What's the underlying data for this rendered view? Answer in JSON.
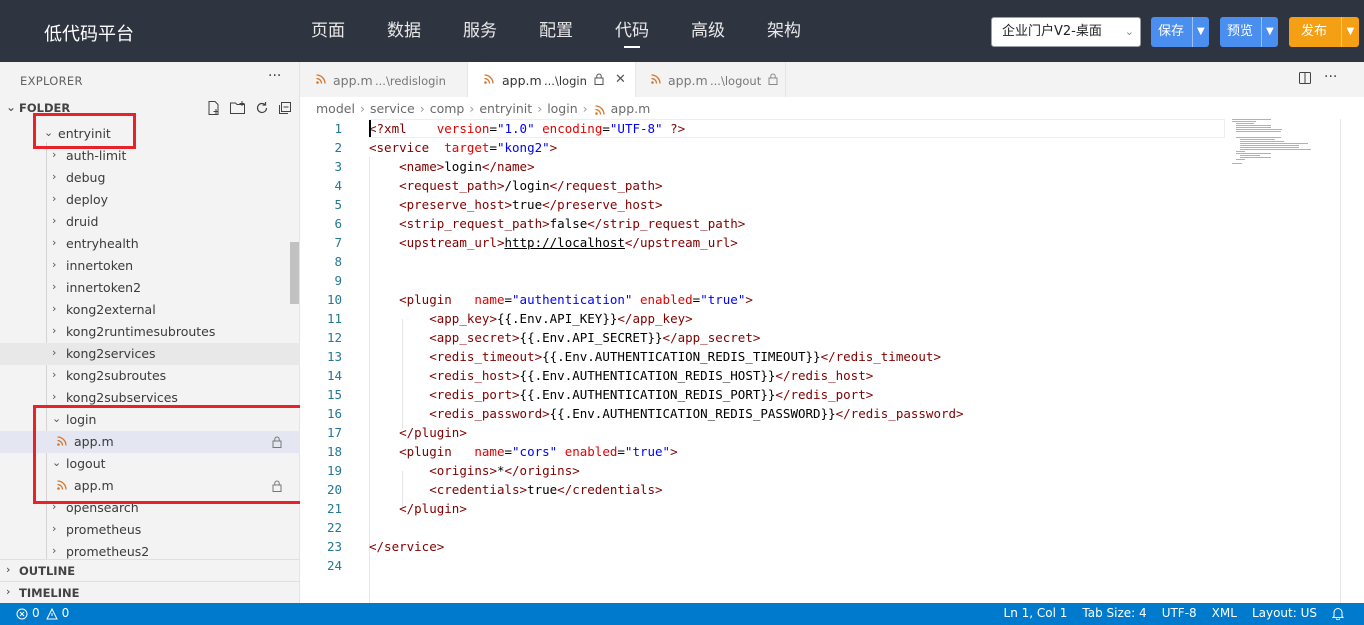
{
  "app": {
    "title": "低代码平台"
  },
  "nav": [
    {
      "label": "页面",
      "active": false
    },
    {
      "label": "数据",
      "active": false
    },
    {
      "label": "服务",
      "active": false
    },
    {
      "label": "配置",
      "active": false
    },
    {
      "label": "代码",
      "active": true
    },
    {
      "label": "高级",
      "active": false
    },
    {
      "label": "架构",
      "active": false
    }
  ],
  "app_select": {
    "value": "企业门户V2-桌面"
  },
  "buttons": {
    "save": "保存",
    "preview": "预览",
    "publish": "发布"
  },
  "explorer": {
    "title": "EXPLORER",
    "folder": "FOLDER",
    "tree": [
      {
        "label": "entryinit",
        "level": 1,
        "expanded": true
      },
      {
        "label": "auth-limit",
        "level": 2,
        "expanded": false
      },
      {
        "label": "debug",
        "level": 2,
        "expanded": false
      },
      {
        "label": "deploy",
        "level": 2,
        "expanded": false
      },
      {
        "label": "druid",
        "level": 2,
        "expanded": false
      },
      {
        "label": "entryhealth",
        "level": 2,
        "expanded": false
      },
      {
        "label": "innertoken",
        "level": 2,
        "expanded": false
      },
      {
        "label": "innertoken2",
        "level": 2,
        "expanded": false
      },
      {
        "label": "kong2external",
        "level": 2,
        "expanded": false
      },
      {
        "label": "kong2runtimesubroutes",
        "level": 2,
        "expanded": false
      },
      {
        "label": "kong2services",
        "level": 2,
        "expanded": false
      },
      {
        "label": "kong2subroutes",
        "level": 2,
        "expanded": false
      },
      {
        "label": "kong2subservices",
        "level": 2,
        "expanded": false
      },
      {
        "label": "login",
        "level": 2,
        "expanded": true
      },
      {
        "label": "app.m",
        "level": 3,
        "file": true,
        "selected": true
      },
      {
        "label": "logout",
        "level": 2,
        "expanded": true
      },
      {
        "label": "app.m",
        "level": 3,
        "file": true
      },
      {
        "label": "opensearch",
        "level": 2,
        "expanded": false
      },
      {
        "label": "prometheus",
        "level": 2,
        "expanded": false
      },
      {
        "label": "prometheus2",
        "level": 2,
        "expanded": false
      }
    ],
    "outline": "OUTLINE",
    "timeline": "TIMELINE"
  },
  "tabs": [
    {
      "name": "app.m",
      "desc": "...\\redislogin",
      "active": false
    },
    {
      "name": "app.m",
      "desc": "...\\login",
      "active": true
    },
    {
      "name": "app.m",
      "desc": "...\\logout",
      "active": false
    }
  ],
  "breadcrumb": [
    "model",
    "service",
    "comp",
    "entryinit",
    "login",
    "app.m"
  ],
  "code_lines": [
    "<?xml version=\"1.0\" encoding=\"UTF-8\" ?>",
    "<service target=\"kong2\">",
    "    <name>login</name>",
    "    <request_path>/login</request_path>",
    "    <preserve_host>true</preserve_host>",
    "    <strip_request_path>false</strip_request_path>",
    "    <upstream_url>http://localhost</upstream_url>",
    "",
    "",
    "    <plugin name=\"authentication\" enabled=\"true\">",
    "        <app_key>{{.Env.API_KEY}}</app_key>",
    "        <app_secret>{{.Env.API_SECRET}}</app_secret>",
    "        <redis_timeout>{{.Env.AUTHENTICATION_REDIS_TIMEOUT}}</redis_timeout>",
    "        <redis_host>{{.Env.AUTHENTICATION_REDIS_HOST}}</redis_host>",
    "        <redis_port>{{.Env.AUTHENTICATION_REDIS_PORT}}</redis_port>",
    "        <redis_password>{{.Env.AUTHENTICATION_REDIS_PASSWORD}}</redis_password>",
    "    </plugin>",
    "    <plugin name=\"cors\" enabled=\"true\">",
    "        <origins>*</origins>",
    "        <credentials>true</credentials>",
    "    </plugin>",
    "",
    "</service>",
    ""
  ],
  "status": {
    "errors": "0",
    "warnings": "0",
    "position": "Ln 1, Col 1",
    "tab_size": "Tab Size: 4",
    "encoding": "UTF-8",
    "language": "XML",
    "layout": "Layout: US"
  },
  "icons": {
    "file": "rss-file-icon",
    "lock": "lock-icon",
    "close": "close-icon",
    "split": "split-editor-icon",
    "more": "more-icon",
    "bell": "bell-icon"
  },
  "colors": {
    "topbar": "#2f3441",
    "blue_button": "#4a8ef0",
    "orange_button": "#f5a014",
    "statusbar": "#007acc",
    "highlight_box": "#e8222a",
    "xml_tag": "#800000",
    "xml_attr": "#e50000",
    "xml_string": "#0000ff"
  }
}
